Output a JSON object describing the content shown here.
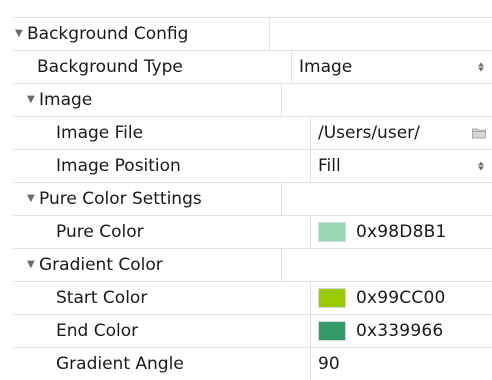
{
  "rows": [
    {
      "label": "Background Config",
      "value": ""
    },
    {
      "label": "Background Type",
      "value": "Image"
    },
    {
      "label": "Image",
      "value": ""
    },
    {
      "label": "Image File",
      "value": "/Users/user/"
    },
    {
      "label": "Image Position",
      "value": "Fill"
    },
    {
      "label": "Pure Color Settings",
      "value": ""
    },
    {
      "label": "Pure Color",
      "value": "0x98D8B1",
      "color": "#98D8B1"
    },
    {
      "label": "Gradient Color",
      "value": ""
    },
    {
      "label": "Start Color",
      "value": "0x99CC00",
      "color": "#99CC00"
    },
    {
      "label": "End Color",
      "value": "0x339966",
      "color": "#339966"
    },
    {
      "label": "Gradient Angle",
      "value": "90"
    }
  ],
  "icons": {
    "expanded": "disclosure-triangle-down-icon",
    "stepper": "stepper-icon",
    "folder": "folder-icon"
  }
}
